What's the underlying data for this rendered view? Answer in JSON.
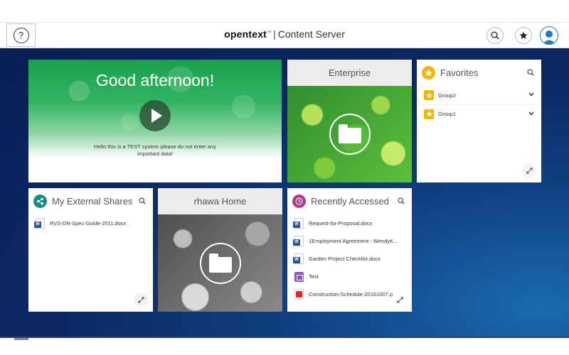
{
  "header": {
    "help_label": "?",
    "brand_name": "opentext",
    "brand_tm": "™",
    "product": "Content Server"
  },
  "tiles": {
    "greeting": {
      "title": "Good afternoon!",
      "message": "Hello this is a TEST system please do not enter any important data!"
    },
    "enterprise": {
      "title": "Enterprise"
    },
    "favorites": {
      "title": "Favorites",
      "items": [
        {
          "label": "Group2"
        },
        {
          "label": "Group1"
        }
      ]
    },
    "shares": {
      "title": "My External Shares",
      "items": [
        {
          "label": "RVS-DN-Spec-Guide-2011.docx",
          "icon": "word-doc-icon"
        }
      ]
    },
    "home": {
      "title": "rhawa Home"
    },
    "recent": {
      "title": "Recently Accessed",
      "items": [
        {
          "label": "Request-for-Proposal.docx",
          "icon": "word-doc-icon"
        },
        {
          "label": "1Employment Agreement - WendyK...",
          "icon": "word-doc-icon"
        },
        {
          "label": "Garden Project Checklist.docx",
          "icon": "word-doc-icon"
        },
        {
          "label": "Test",
          "icon": "form-icon"
        },
        {
          "label": "Construction-Schedule-20161007.p",
          "icon": "pdf-icon"
        }
      ]
    }
  },
  "colors": {
    "favorites_accent": "#f4b400",
    "shares_accent": "#1a8c82",
    "recent_accent": "#b03a8c",
    "background": "#0b2763"
  }
}
